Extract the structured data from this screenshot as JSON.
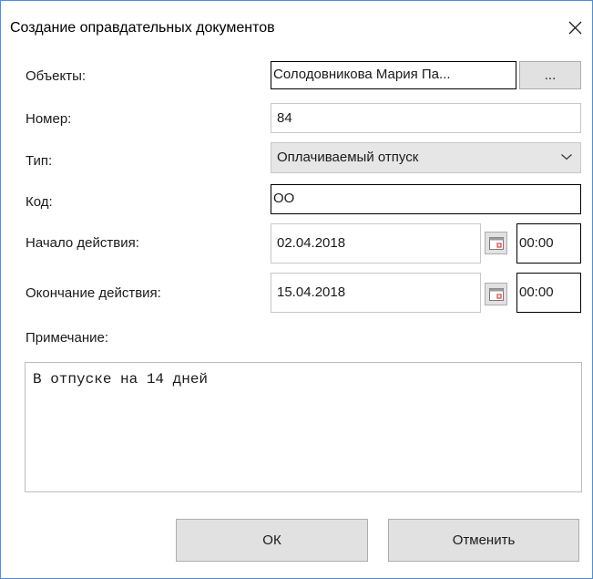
{
  "window": {
    "title": "Создание оправдательных документов"
  },
  "form": {
    "objects": {
      "label": "Объекты:",
      "value": "Солодовникова Мария Па...",
      "browse_label": "..."
    },
    "number": {
      "label": "Номер:",
      "value": "84"
    },
    "type": {
      "label": "Тип:",
      "value": "Оплачиваемый отпуск"
    },
    "code": {
      "label": "Код:",
      "value": "ОО"
    },
    "start": {
      "label": "Начало действия:",
      "date": "02.04.2018",
      "time": "00:00"
    },
    "end": {
      "label": "Окончание действия:",
      "date": "15.04.2018",
      "time": "00:00"
    },
    "note": {
      "label": "Примечание:",
      "value": "В отпуске на 14 дней"
    }
  },
  "buttons": {
    "ok": "ОК",
    "cancel": "Отменить"
  },
  "icons": {
    "close": "close-icon",
    "combo": "chevron-down-icon",
    "calendar": "calendar-icon"
  },
  "colors": {
    "window_border": "#4a90d9",
    "button_face": "#e1e1e1",
    "calendar_accent": "#e0403a"
  }
}
